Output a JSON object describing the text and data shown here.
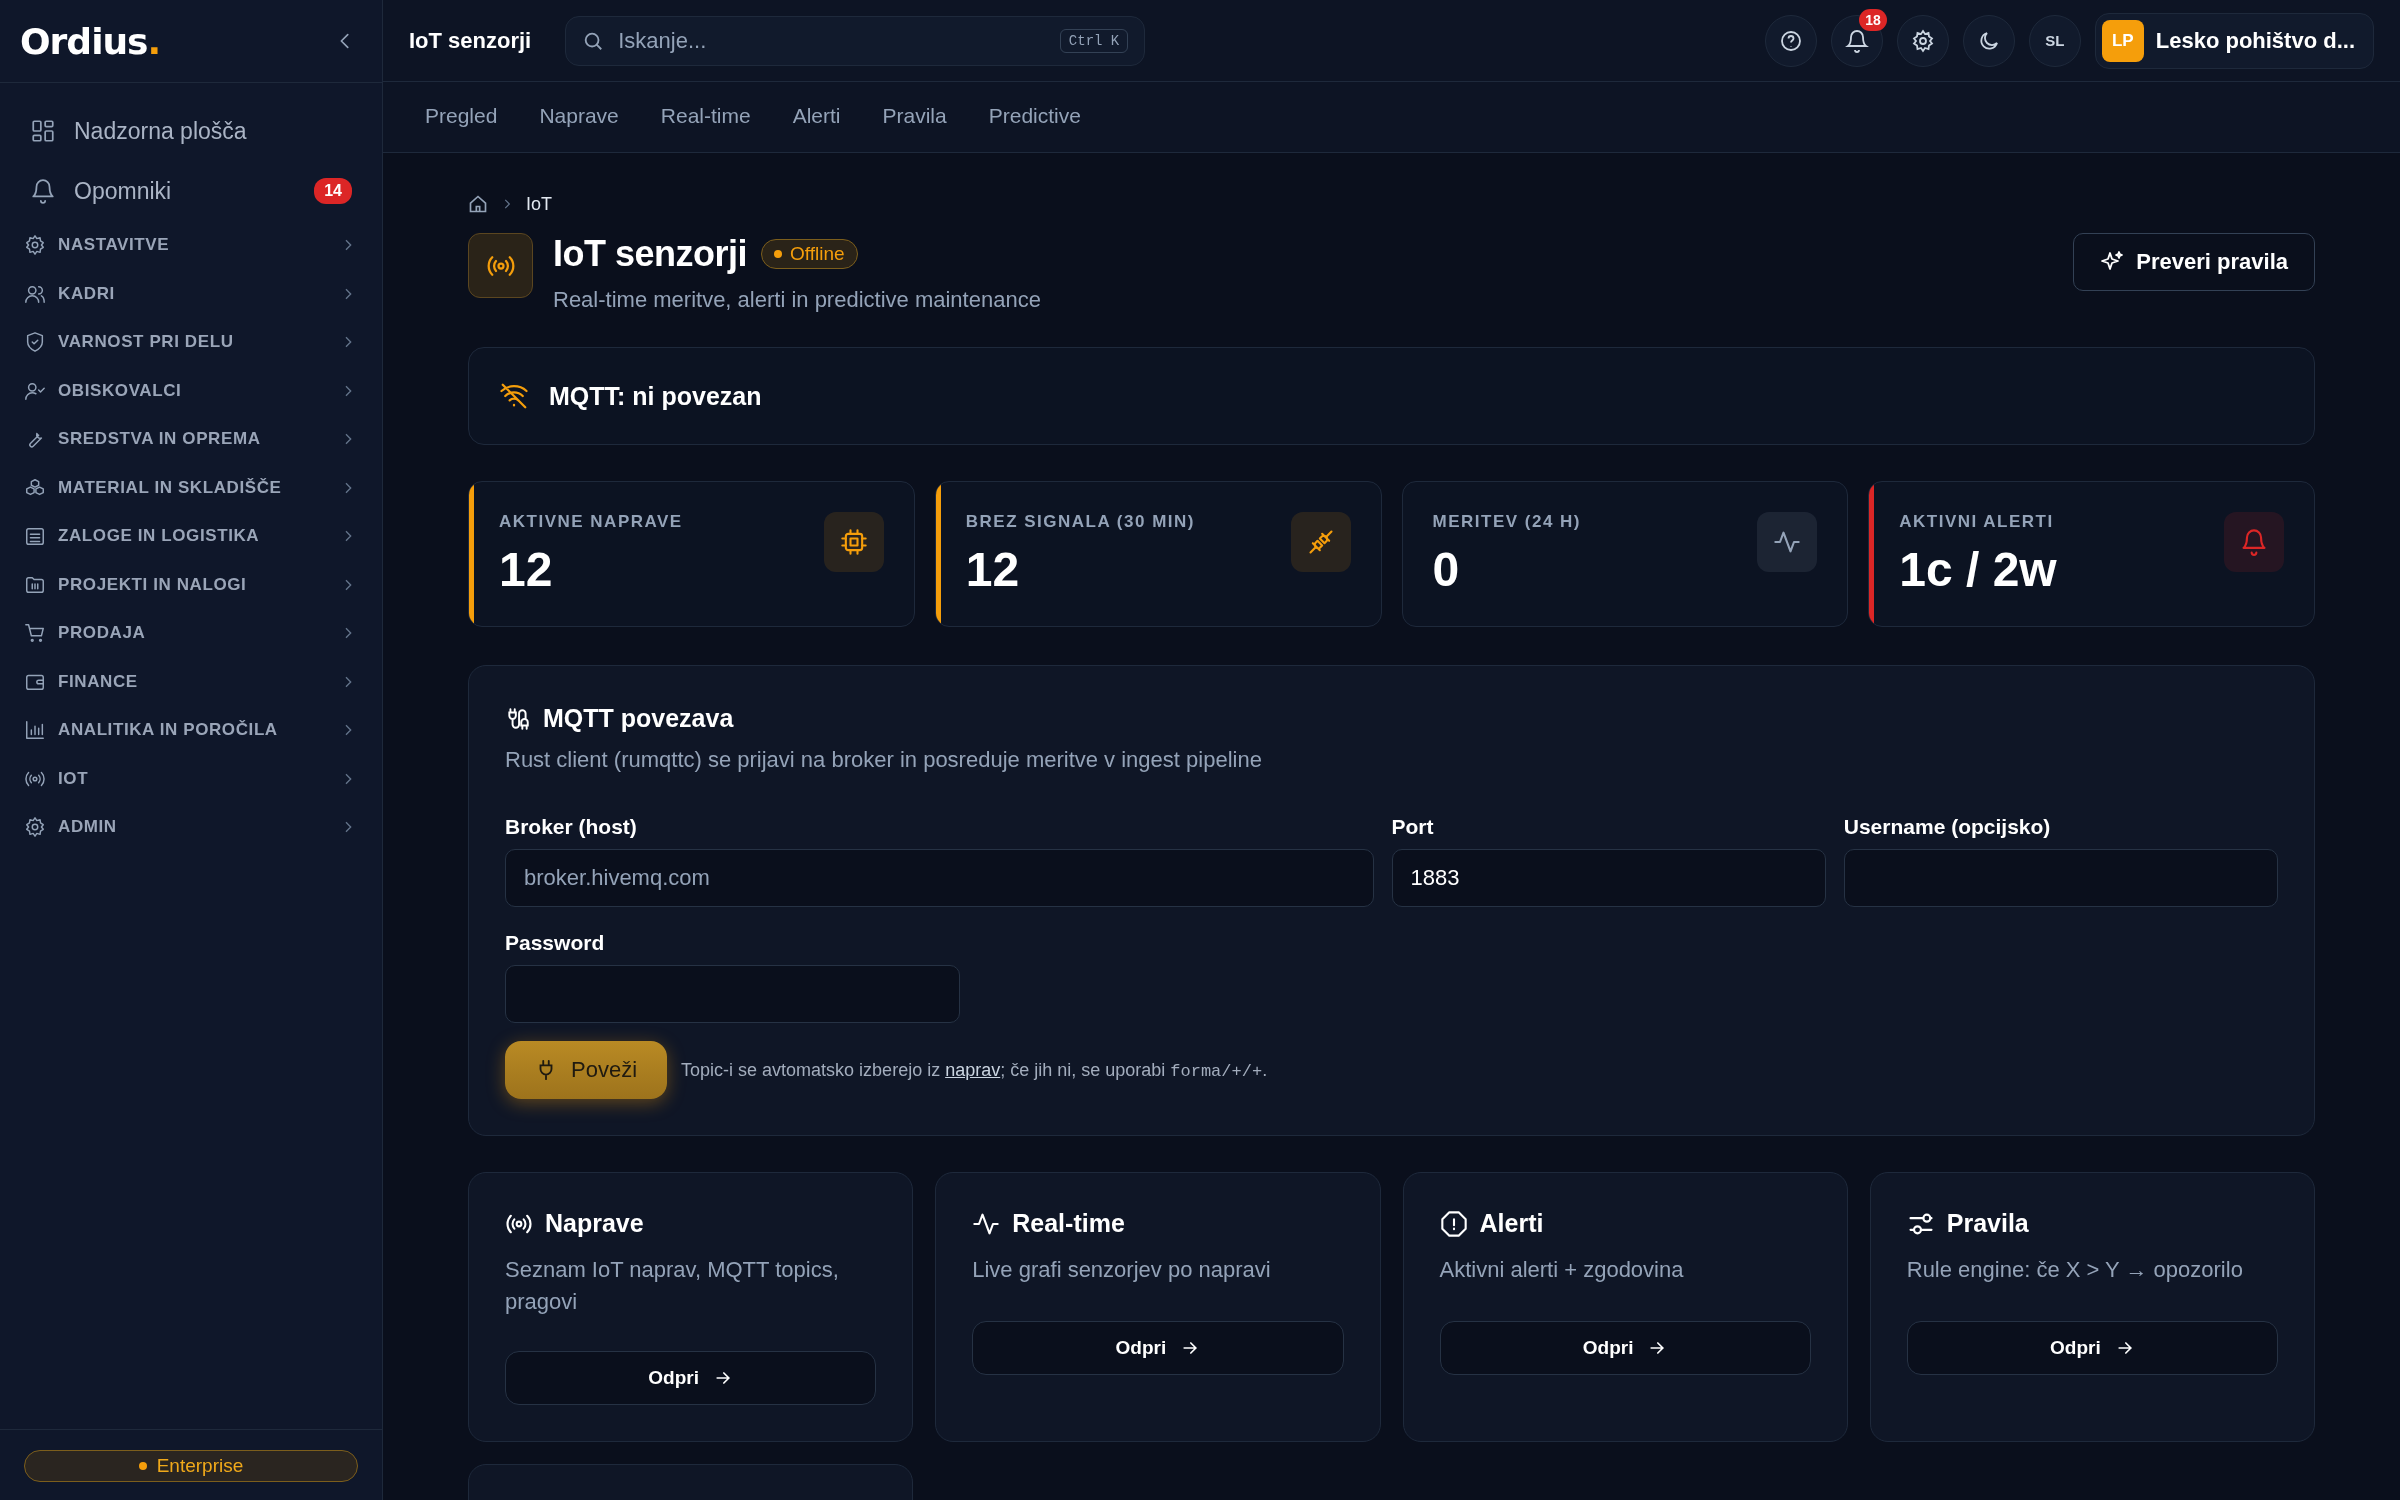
{
  "sidebar": {
    "logo": "Ordius",
    "logo_mark": ".",
    "top_items": [
      {
        "label": "Nadzorna plošča"
      },
      {
        "label": "Opomniki",
        "badge": "14"
      }
    ],
    "sections": [
      {
        "label": "NASTAVITVE"
      },
      {
        "label": "KADRI"
      },
      {
        "label": "VARNOST PRI DELU"
      },
      {
        "label": "OBISKOVALCI"
      },
      {
        "label": "SREDSTVA IN OPREMA"
      },
      {
        "label": "MATERIAL IN SKLADIŠČE"
      },
      {
        "label": "ZALOGE IN LOGISTIKA"
      },
      {
        "label": "PROJEKTI IN NALOGI"
      },
      {
        "label": "PRODAJA"
      },
      {
        "label": "FINANCE"
      },
      {
        "label": "ANALITIKA IN POROČILA"
      },
      {
        "label": "IOT"
      },
      {
        "label": "ADMIN"
      }
    ],
    "plan": "Enterprise"
  },
  "topbar": {
    "page_title": "IoT senzorji",
    "search": {
      "placeholder": "Iskanje...",
      "shortcut": "Ctrl K"
    },
    "notifications": "18",
    "language": "SL",
    "avatar": "LP",
    "organization": "Lesko pohištvo d..."
  },
  "tabs": [
    {
      "label": "Pregled",
      "selected": false
    },
    {
      "label": "Naprave",
      "selected": false
    },
    {
      "label": "Real-time",
      "selected": false
    },
    {
      "label": "Alerti",
      "selected": false
    },
    {
      "label": "Pravila",
      "selected": false
    },
    {
      "label": "Predictive",
      "selected": false
    }
  ],
  "breadcrumb": [
    "IoT"
  ],
  "header": {
    "title": "IoT senzorji",
    "status": "Offline",
    "subtitle": "Real-time meritve, alerti in predictive maintenance",
    "action": "Preveri pravila"
  },
  "mqtt_banner": "MQTT: ni povezan",
  "stats": [
    {
      "label": "AKTIVNE NAPRAVE",
      "value": "12",
      "color": "#f59e0b",
      "accented": true
    },
    {
      "label": "BREZ SIGNALA (30 MIN)",
      "value": "12",
      "color": "#f59e0b",
      "accented": true
    },
    {
      "label": "MERITEV (24 H)",
      "value": "0",
      "color": "#94a3b8",
      "accented": false
    },
    {
      "label": "AKTIVNI ALERTI",
      "value": "1c / 2w",
      "color": "#dc2626",
      "accented": true
    }
  ],
  "mqtt_form": {
    "title": "MQTT povezava",
    "description": "Rust client (rumqttc) se prijavi na broker in posreduje meritve v ingest pipeline",
    "fields": [
      {
        "label": "Broker (host)",
        "placeholder": "broker.hivemq.com"
      },
      {
        "label": "Port",
        "value": "1883"
      },
      {
        "label": "Username (opcijsko)"
      },
      {
        "label": "Password"
      }
    ],
    "button": "Poveži",
    "note": {
      "before": "Topic-i se avtomatsko izberejo iz ",
      "link": "naprav",
      "middle": "; če jih ni, se uporabi ",
      "code": "forma/+/+",
      "after": "."
    }
  },
  "cards": [
    {
      "title": "Naprave",
      "description": "Seznam IoT naprav, MQTT topics, pragovi",
      "button": "Odpri"
    },
    {
      "title": "Real-time",
      "description": "Live grafi senzorjev po napravi",
      "button": "Odpri"
    },
    {
      "title": "Alerti",
      "description": "Aktivni alerti + zgodovina",
      "button": "Odpri"
    },
    {
      "title": "Pravila",
      "description": "Rule engine: če X > Y → opozorilo",
      "button": "Odpri"
    }
  ]
}
